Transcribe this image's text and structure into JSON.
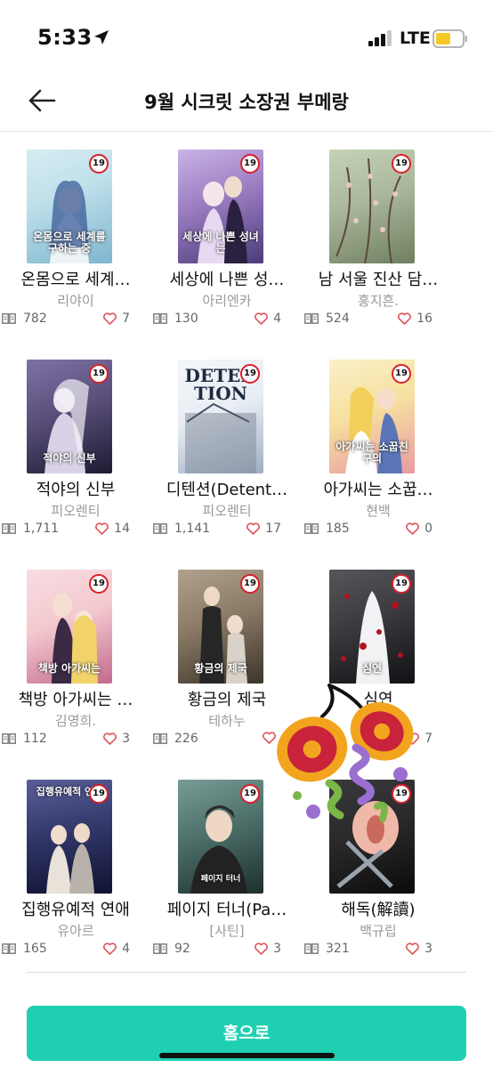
{
  "status_bar": {
    "time": "5:33",
    "network": "LTE"
  },
  "header": {
    "title": "9월 시크릿 소장권 부메랑"
  },
  "books": [
    {
      "title": "온몸으로 세계를 구하는 중",
      "title_display": "온몸으로 세계…",
      "author": "리야이",
      "views": "782",
      "likes": "7",
      "cover_text": "온몸으로 세계를 구하는 중",
      "colors": [
        "#bfe0ea",
        "#7fb6cf"
      ]
    },
    {
      "title": "세상에 나쁜 성녀는 없다",
      "title_display": "세상에 나쁜 성…",
      "author": "아리엔카",
      "views": "130",
      "likes": "4",
      "cover_text": "세상에 나쁜 성녀는",
      "colors": [
        "#9a7cc0",
        "#4b3c7a"
      ]
    },
    {
      "title": "남 서울 진산 담",
      "title_display": "남 서울 진산 담…",
      "author": "홍지흔.",
      "views": "524",
      "likes": "16",
      "cover_text": "",
      "colors": [
        "#a9b79a",
        "#6e7f5e"
      ]
    },
    {
      "title": "적야의 신부",
      "title_display": "적야의 신부",
      "author": "피오렌티",
      "views": "1,711",
      "likes": "14",
      "cover_text": "적야의 신부",
      "colors": [
        "#5a4f7a",
        "#1e1b33"
      ]
    },
    {
      "title": "디텐션(Detention)",
      "title_display": "디텐션(Detent…",
      "author": "피오렌티",
      "views": "1,141",
      "likes": "17",
      "cover_text": "DETENTION",
      "colors": [
        "#e9eef4",
        "#9eaec4"
      ]
    },
    {
      "title": "아가씨는 소꿉친구의",
      "title_display": "아가씨는 소꿉…",
      "author": "현백",
      "views": "185",
      "likes": "0",
      "cover_text": "아가씨는 소꿉친구의",
      "colors": [
        "#f6e0a0",
        "#e89aa3"
      ]
    },
    {
      "title": "책방 아가씨는 한량과 결혼하고 싶다",
      "title_display": "책방 아가씨는 …",
      "author": "김영희.",
      "views": "112",
      "likes": "3",
      "cover_text": "책방 아가씨는",
      "colors": [
        "#f3c9cf",
        "#c26a8c"
      ]
    },
    {
      "title": "황금의 제국",
      "title_display": "황금의 제국",
      "author": "테하누",
      "views": "226",
      "likes": "",
      "cover_text": "황금의 제국",
      "colors": [
        "#8a7a66",
        "#3c342b"
      ]
    },
    {
      "title": "심연",
      "title_display": "심연",
      "author": "",
      "views": "",
      "likes": "7",
      "cover_text": "심연",
      "colors": [
        "#3b3b3f",
        "#111114"
      ]
    },
    {
      "title": "집행유예적 연애",
      "title_display": "집행유예적 연애",
      "author": "유아르",
      "views": "165",
      "likes": "4",
      "cover_text": "집행유예적 연애",
      "colors": [
        "#33386a",
        "#101232"
      ]
    },
    {
      "title": "페이지 터너(Page Turner)",
      "title_display": "페이지 터너(Pa…",
      "author": "[사틴]",
      "views": "92",
      "likes": "3",
      "cover_text": "페이지 터너",
      "colors": [
        "#4d6f6a",
        "#1d2f2d"
      ]
    },
    {
      "title": "해독(解讀)",
      "title_display": "해독(解讀)",
      "author": "백규립",
      "views": "321",
      "likes": "3",
      "cover_text": "",
      "colors": [
        "#2a2a2c",
        "#0b0b0c"
      ]
    }
  ],
  "age_badge": "19",
  "footer": {
    "home_button": "홈으로"
  },
  "colors": {
    "accent": "#1fcfb2",
    "badge_ring": "#d8202a",
    "heart": "#e0525a"
  }
}
